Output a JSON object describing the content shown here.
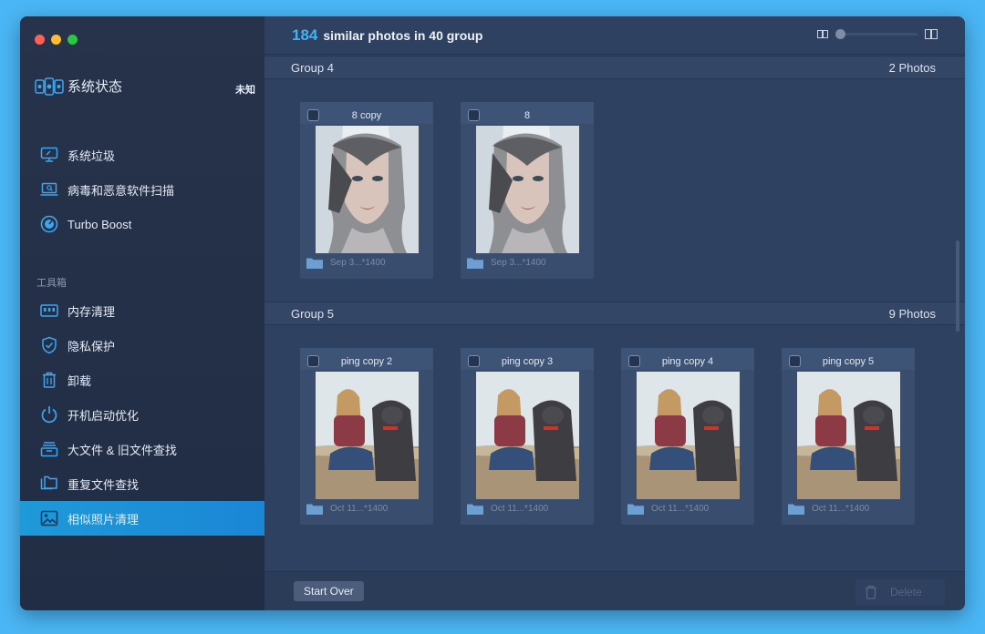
{
  "sidebar": {
    "title": "系统状态",
    "status": "未知",
    "section_label": "工具箱",
    "items": [
      {
        "label": "系统垃圾",
        "icon": "monitor-clean-icon"
      },
      {
        "label": "病毒和恶意软件扫描",
        "icon": "laptop-scan-icon"
      },
      {
        "label": "Turbo Boost",
        "icon": "speedometer-icon"
      },
      {
        "label": "内存清理",
        "icon": "memory-icon"
      },
      {
        "label": "隐私保护",
        "icon": "shield-check-icon"
      },
      {
        "label": "卸载",
        "icon": "trash-icon"
      },
      {
        "label": "开机启动优化",
        "icon": "power-icon"
      },
      {
        "label": "大文件 & 旧文件查找",
        "icon": "file-stack-icon"
      },
      {
        "label": "重复文件查找",
        "icon": "duplicate-folder-icon"
      },
      {
        "label": "相似照片清理",
        "icon": "photo-icon",
        "active": true
      }
    ]
  },
  "header": {
    "count": "184",
    "summary": "similar photos in 40 group"
  },
  "groups": [
    {
      "title": "Group 4",
      "count_label": "2 Photos",
      "photos": [
        {
          "name": "8 copy",
          "meta": "Sep 3...*1400"
        },
        {
          "name": "8",
          "meta": "Sep 3...*1400"
        }
      ]
    },
    {
      "title": "Group 5",
      "count_label": "9 Photos",
      "photos": [
        {
          "name": "ping copy 2",
          "meta": "Oct 11...*1400"
        },
        {
          "name": "ping copy 3",
          "meta": "Oct 11...*1400"
        },
        {
          "name": "ping copy 4",
          "meta": "Oct 11...*1400"
        },
        {
          "name": "ping copy 5",
          "meta": "Oct 11...*1400"
        }
      ]
    }
  ],
  "footer": {
    "start_over_label": "Start Over",
    "delete_label": "Delete"
  },
  "colors": {
    "accent": "#41b2f3",
    "active_nav": "#1b8fd8",
    "sidebar_bg": "#232f46",
    "main_bg": "#2f4160"
  }
}
